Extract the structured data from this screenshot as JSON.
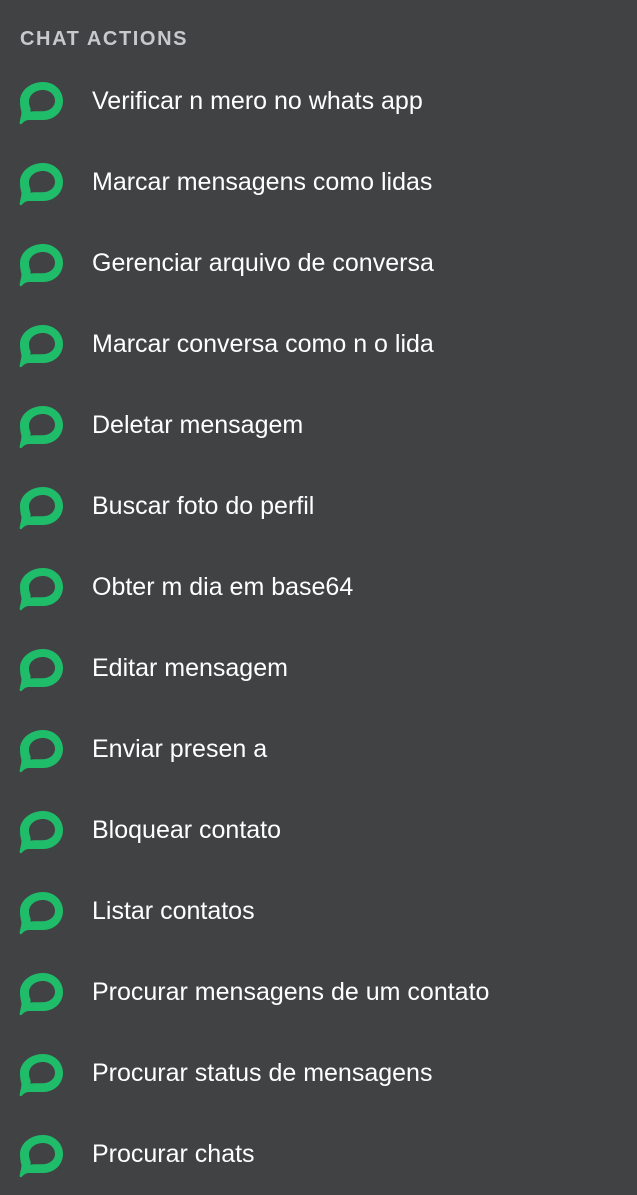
{
  "section": {
    "title": "CHAT ACTIONS"
  },
  "colors": {
    "background": "#414244",
    "accent": "#1fbd6a",
    "title": "#c8c9cc",
    "text": "#ffffff"
  },
  "actions": [
    {
      "label": "Verificar n mero no whats app",
      "icon": "chat-bubble-icon"
    },
    {
      "label": "Marcar mensagens como lidas",
      "icon": "chat-bubble-icon"
    },
    {
      "label": "Gerenciar arquivo de conversa",
      "icon": "chat-bubble-icon"
    },
    {
      "label": "Marcar conversa como n o lida",
      "icon": "chat-bubble-icon"
    },
    {
      "label": "Deletar mensagem",
      "icon": "chat-bubble-icon"
    },
    {
      "label": "Buscar foto do perfil",
      "icon": "chat-bubble-icon"
    },
    {
      "label": "Obter m dia em base64",
      "icon": "chat-bubble-icon"
    },
    {
      "label": "Editar mensagem",
      "icon": "chat-bubble-icon"
    },
    {
      "label": "Enviar presen a",
      "icon": "chat-bubble-icon"
    },
    {
      "label": "Bloquear contato",
      "icon": "chat-bubble-icon"
    },
    {
      "label": "Listar contatos",
      "icon": "chat-bubble-icon"
    },
    {
      "label": "Procurar mensagens de um contato",
      "icon": "chat-bubble-icon"
    },
    {
      "label": "Procurar status de mensagens",
      "icon": "chat-bubble-icon"
    },
    {
      "label": "Procurar chats",
      "icon": "chat-bubble-icon"
    }
  ]
}
